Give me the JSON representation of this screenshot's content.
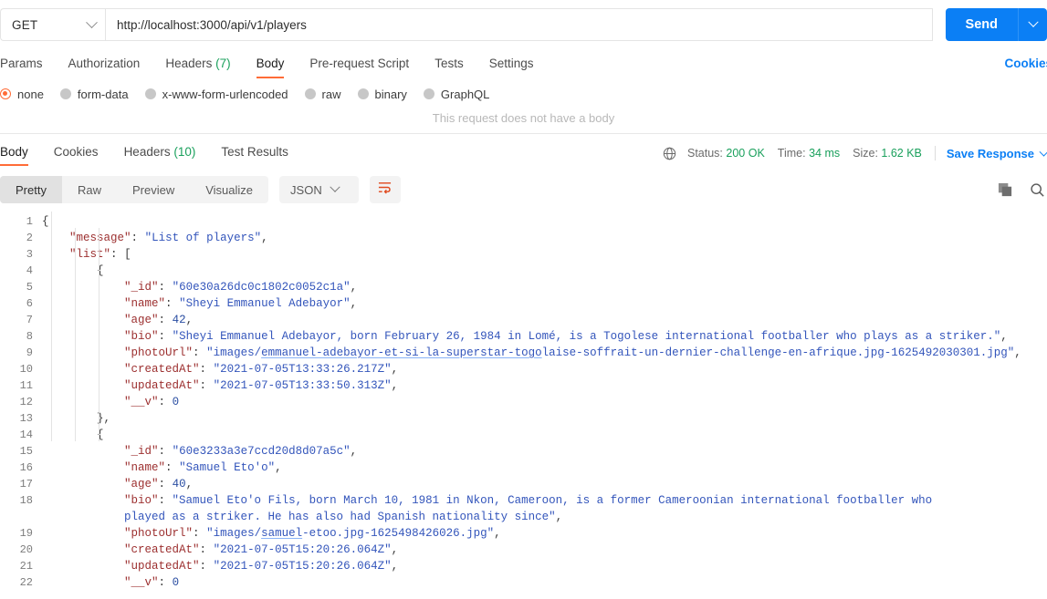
{
  "request": {
    "method": "GET",
    "url": "http://localhost:3000/api/v1/players",
    "send_label": "Send",
    "tabs": [
      {
        "label": "Params",
        "count": "",
        "active": false
      },
      {
        "label": "Authorization",
        "count": "",
        "active": false
      },
      {
        "label": "Headers",
        "count": "(7)",
        "active": false
      },
      {
        "label": "Body",
        "count": "",
        "active": true
      },
      {
        "label": "Pre-request Script",
        "count": "",
        "active": false
      },
      {
        "label": "Tests",
        "count": "",
        "active": false
      },
      {
        "label": "Settings",
        "count": "",
        "active": false
      }
    ],
    "cookies_link": "Cookies",
    "body_types": [
      {
        "label": "none",
        "selected": true
      },
      {
        "label": "form-data",
        "selected": false
      },
      {
        "label": "x-www-form-urlencoded",
        "selected": false
      },
      {
        "label": "raw",
        "selected": false
      },
      {
        "label": "binary",
        "selected": false
      },
      {
        "label": "GraphQL",
        "selected": false
      }
    ],
    "no_body_message": "This request does not have a body"
  },
  "response": {
    "tabs": [
      {
        "label": "Body",
        "count": "",
        "active": true
      },
      {
        "label": "Cookies",
        "count": "",
        "active": false
      },
      {
        "label": "Headers",
        "count": "(10)",
        "active": false
      },
      {
        "label": "Test Results",
        "count": "",
        "active": false
      }
    ],
    "status_label": "Status:",
    "status_value": "200 OK",
    "time_label": "Time:",
    "time_value": "34 ms",
    "size_label": "Size:",
    "size_value": "1.62 KB",
    "save_response": "Save Response",
    "view_modes": [
      {
        "label": "Pretty",
        "active": true
      },
      {
        "label": "Raw",
        "active": false
      },
      {
        "label": "Preview",
        "active": false
      },
      {
        "label": "Visualize",
        "active": false
      }
    ],
    "format_selected": "JSON"
  },
  "colors": {
    "accent_orange": "#ff6c37",
    "link_blue": "#0b7ff5",
    "status_green": "#1aa05c",
    "json_key": "#9c2f2f",
    "json_string": "#3355bb"
  },
  "body_json": {
    "message": "List of players",
    "list": [
      {
        "_id": "60e30a26dc0c1802c0052c1a",
        "name": "Sheyi Emmanuel Adebayor",
        "age": 42,
        "bio": "Sheyi Emmanuel Adebayor, born February 26, 1984 in Lomé, is a Togolese international footballer who plays as a striker.",
        "photoUrl": "images/emmanuel-adebayor-et-si-la-superstar-togolaise-soffrait-un-dernier-challenge-en-afrique.jpg-1625492030301.jpg",
        "createdAt": "2021-07-05T13:33:26.217Z",
        "updatedAt": "2021-07-05T13:33:50.313Z",
        "__v": 0
      },
      {
        "_id": "60e3233a3e7ccd20d8d07a5c",
        "name": "Samuel Eto'o",
        "age": 40,
        "bio": "Samuel Eto'o Fils, born March 10, 1981 in Nkon, Cameroon, is a former Cameroonian international footballer who played as a striker. He has also had Spanish nationality since",
        "photoUrl": "images/samuel-etoo.jpg-1625498426026.jpg",
        "createdAt": "2021-07-05T15:20:26.064Z",
        "updatedAt": "2021-07-05T15:20:26.064Z",
        "__v": 0
      }
    ]
  },
  "code_lines": [
    {
      "n": "1",
      "indent": 0,
      "html": "<span class='tok-brace'>{</span>"
    },
    {
      "n": "2",
      "indent": 1,
      "html": "<span class='tok-key'>\"message\"</span><span class='tok-punc'>:</span> <span class='tok-str'>\"List of players\"</span><span class='tok-punc'>,</span>"
    },
    {
      "n": "3",
      "indent": 1,
      "html": "<span class='tok-key'>\"list\"</span><span class='tok-punc'>:</span> <span class='tok-brace'>[</span>"
    },
    {
      "n": "4",
      "indent": 2,
      "html": "<span class='tok-brace'>{</span>"
    },
    {
      "n": "5",
      "indent": 3,
      "html": "<span class='tok-key'>\"_id\"</span><span class='tok-punc'>:</span> <span class='tok-str'>\"60e30a26dc0c1802c0052c1a\"</span><span class='tok-punc'>,</span>"
    },
    {
      "n": "6",
      "indent": 3,
      "html": "<span class='tok-key'>\"name\"</span><span class='tok-punc'>:</span> <span class='tok-str'>\"Sheyi Emmanuel Adebayor\"</span><span class='tok-punc'>,</span>"
    },
    {
      "n": "7",
      "indent": 3,
      "html": "<span class='tok-key'>\"age\"</span><span class='tok-punc'>:</span> <span class='tok-num'>42</span><span class='tok-punc'>,</span>"
    },
    {
      "n": "8",
      "indent": 3,
      "html": "<span class='tok-key'>\"bio\"</span><span class='tok-punc'>:</span> <span class='tok-str'>\"Sheyi Emmanuel Adebayor, born February 26, 1984 in Lomé, is a Togolese international footballer who plays as a striker.\"</span><span class='tok-punc'>,</span>"
    },
    {
      "n": "9",
      "indent": 3,
      "html": "<span class='tok-key'>\"photoUrl\"</span><span class='tok-punc'>:</span> <span class='tok-str'>\"images/<span class='spell'>emmanuel-adebayor-et-si-la-superstar-togo</span>laise-soffrait-un-dernier-challenge-en-afrique.jpg-1625492030301.jpg\"</span><span class='tok-punc'>,</span>"
    },
    {
      "n": "10",
      "indent": 3,
      "html": "<span class='tok-key'>\"createdAt\"</span><span class='tok-punc'>:</span> <span class='tok-str'>\"2021-07-05T13:33:26.217Z\"</span><span class='tok-punc'>,</span>"
    },
    {
      "n": "11",
      "indent": 3,
      "html": "<span class='tok-key'>\"updatedAt\"</span><span class='tok-punc'>:</span> <span class='tok-str'>\"2021-07-05T13:33:50.313Z\"</span><span class='tok-punc'>,</span>"
    },
    {
      "n": "12",
      "indent": 3,
      "html": "<span class='tok-key'>\"__v\"</span><span class='tok-punc'>:</span> <span class='tok-num'>0</span>"
    },
    {
      "n": "13",
      "indent": 2,
      "html": "<span class='tok-brace'>}</span><span class='tok-punc'>,</span>"
    },
    {
      "n": "14",
      "indent": 2,
      "html": "<span class='tok-brace'>{</span>"
    },
    {
      "n": "15",
      "indent": 3,
      "html": "<span class='tok-key'>\"_id\"</span><span class='tok-punc'>:</span> <span class='tok-str'>\"60e3233a3e7ccd20d8d07a5c\"</span><span class='tok-punc'>,</span>"
    },
    {
      "n": "16",
      "indent": 3,
      "html": "<span class='tok-key'>\"name\"</span><span class='tok-punc'>:</span> <span class='tok-str'>\"Samuel Eto'o\"</span><span class='tok-punc'>,</span>"
    },
    {
      "n": "17",
      "indent": 3,
      "html": "<span class='tok-key'>\"age\"</span><span class='tok-punc'>:</span> <span class='tok-num'>40</span><span class='tok-punc'>,</span>"
    },
    {
      "n": "18",
      "indent": 3,
      "wrap": true,
      "html": "<span class='tok-key'>\"bio\"</span><span class='tok-punc'>:</span> <span class='tok-str'>\"Samuel Eto'o Fils, born March 10, 1981 in Nkon, Cameroon, is a former Cameroonian international footballer who played as a striker. He has also had Spanish nationality since\"</span><span class='tok-punc'>,</span>"
    },
    {
      "n": "19",
      "indent": 3,
      "html": "<span class='tok-key'>\"photoUrl\"</span><span class='tok-punc'>:</span> <span class='tok-str'>\"images/<span class='spell'>samuel</span>-etoo.jpg-1625498426026.jpg\"</span><span class='tok-punc'>,</span>"
    },
    {
      "n": "20",
      "indent": 3,
      "html": "<span class='tok-key'>\"createdAt\"</span><span class='tok-punc'>:</span> <span class='tok-str'>\"2021-07-05T15:20:26.064Z\"</span><span class='tok-punc'>,</span>"
    },
    {
      "n": "21",
      "indent": 3,
      "html": "<span class='tok-key'>\"updatedAt\"</span><span class='tok-punc'>:</span> <span class='tok-str'>\"2021-07-05T15:20:26.064Z\"</span><span class='tok-punc'>,</span>"
    },
    {
      "n": "22",
      "indent": 3,
      "html": "<span class='tok-key'>\"__v\"</span><span class='tok-punc'>:</span> <span class='tok-num'>0</span>"
    }
  ]
}
